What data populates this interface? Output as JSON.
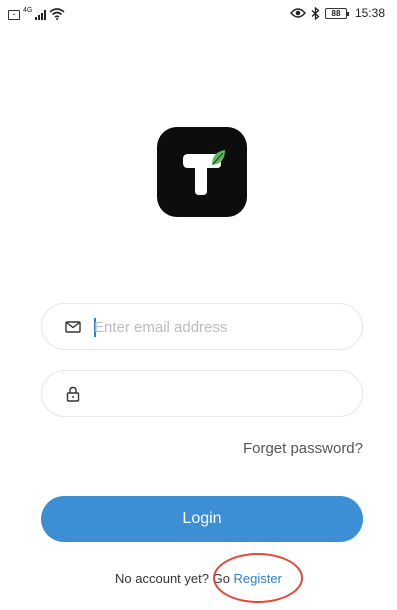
{
  "status_bar": {
    "network_label": "4G",
    "battery_level": "88",
    "time": "15:38",
    "icons": [
      "sim-icon",
      "signal-icon",
      "wifi-icon",
      "eye-icon",
      "bluetooth-icon",
      "battery-icon"
    ]
  },
  "logo": {
    "letter": "T",
    "background_color": "#0d0d0d",
    "leaf_color": "#5db85c",
    "icon": "app-logo"
  },
  "form": {
    "email": {
      "placeholder": "Enter email address",
      "value": "",
      "icon": "mail-icon"
    },
    "password": {
      "placeholder": "",
      "value": "",
      "icon": "lock-icon"
    },
    "forget_password_label": "Forget password?",
    "login_button_label": "Login"
  },
  "register": {
    "prompt": "No account yet? Go ",
    "link_label": "Register"
  },
  "colors": {
    "accent": "#3d8fd5",
    "link": "#2f7fd1",
    "annotation": "#e04a3a"
  }
}
